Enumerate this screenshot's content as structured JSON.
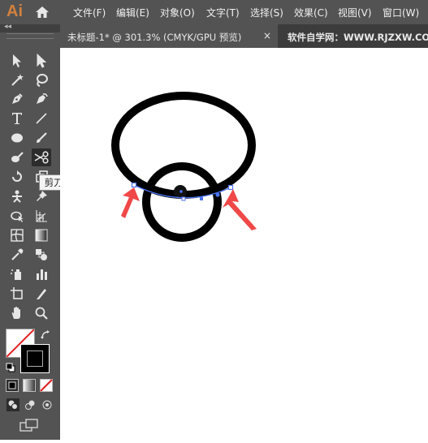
{
  "app": {
    "logo": "Ai"
  },
  "menu": {
    "items": [
      "文件(F)",
      "编辑(E)",
      "对象(O)",
      "文字(T)",
      "选择(S)",
      "效果(C)",
      "视图(V)",
      "窗口(W)"
    ]
  },
  "tabs": {
    "active_title": "未标题-1* @ 301.3% (CMYK/GPU 预览)",
    "close_glyph": "×",
    "other": "软件自学网：WWW.RJZXW.COM"
  },
  "toolbar": {
    "collapse_glyph": "◂◂",
    "tooltip": "剪刀工具 (C)",
    "tools": [
      {
        "name": "selection-tool",
        "icon": "arrow-icon"
      },
      {
        "name": "direct-selection-tool",
        "icon": "white-arrow-icon"
      },
      {
        "name": "magic-wand-tool",
        "icon": "wand-icon"
      },
      {
        "name": "lasso-tool",
        "icon": "lasso-icon"
      },
      {
        "name": "pen-tool",
        "icon": "pen-icon"
      },
      {
        "name": "curvature-tool",
        "icon": "curvature-icon"
      },
      {
        "name": "type-tool",
        "icon": "type-icon"
      },
      {
        "name": "line-tool",
        "icon": "line-icon"
      },
      {
        "name": "ellipse-tool",
        "icon": "ellipse-icon"
      },
      {
        "name": "paintbrush-tool",
        "icon": "brush-icon"
      },
      {
        "name": "eraser-tool",
        "icon": "eraser-icon"
      },
      {
        "name": "scissors-tool",
        "icon": "scissors-icon"
      },
      {
        "name": "rotate-tool",
        "icon": "rotate-icon"
      },
      {
        "name": "scale-tool",
        "icon": "scale-icon"
      },
      {
        "name": "puppet-warp-tool",
        "icon": "puppet-icon"
      },
      {
        "name": "pin-tool",
        "icon": "pin-icon"
      },
      {
        "name": "shape-builder-tool",
        "icon": "shape-builder-icon"
      },
      {
        "name": "perspective-grid-tool",
        "icon": "perspective-icon"
      },
      {
        "name": "mesh-tool",
        "icon": "mesh-icon"
      },
      {
        "name": "gradient-tool",
        "icon": "gradient-icon"
      },
      {
        "name": "eyedropper-tool",
        "icon": "eyedropper-icon"
      },
      {
        "name": "blend-tool",
        "icon": "blend-icon"
      },
      {
        "name": "symbol-sprayer-tool",
        "icon": "symbol-sprayer-icon"
      },
      {
        "name": "column-graph-tool",
        "icon": "graph-icon"
      },
      {
        "name": "artboard-tool",
        "icon": "artboard-icon"
      },
      {
        "name": "slice-tool",
        "icon": "slice-icon"
      },
      {
        "name": "hand-tool",
        "icon": "hand-icon"
      },
      {
        "name": "zoom-tool",
        "icon": "zoom-icon"
      }
    ],
    "active_tool": "scissors-tool"
  },
  "colors": {
    "menubar_bg": "#535353",
    "panel_bg": "#535353",
    "tab_inactive_bg": "#3c3c3c",
    "canvas_bg": "#ffffff",
    "logo": "#d2813e",
    "path_selection": "#4a72f0",
    "annotation_arrow": "#f04848",
    "none_slash": "#e02020"
  },
  "canvas": {
    "artwork": "two stroked black circles, intersecting arc selected with anchor points",
    "annotations": "two red arrows pointing to anchor points"
  }
}
